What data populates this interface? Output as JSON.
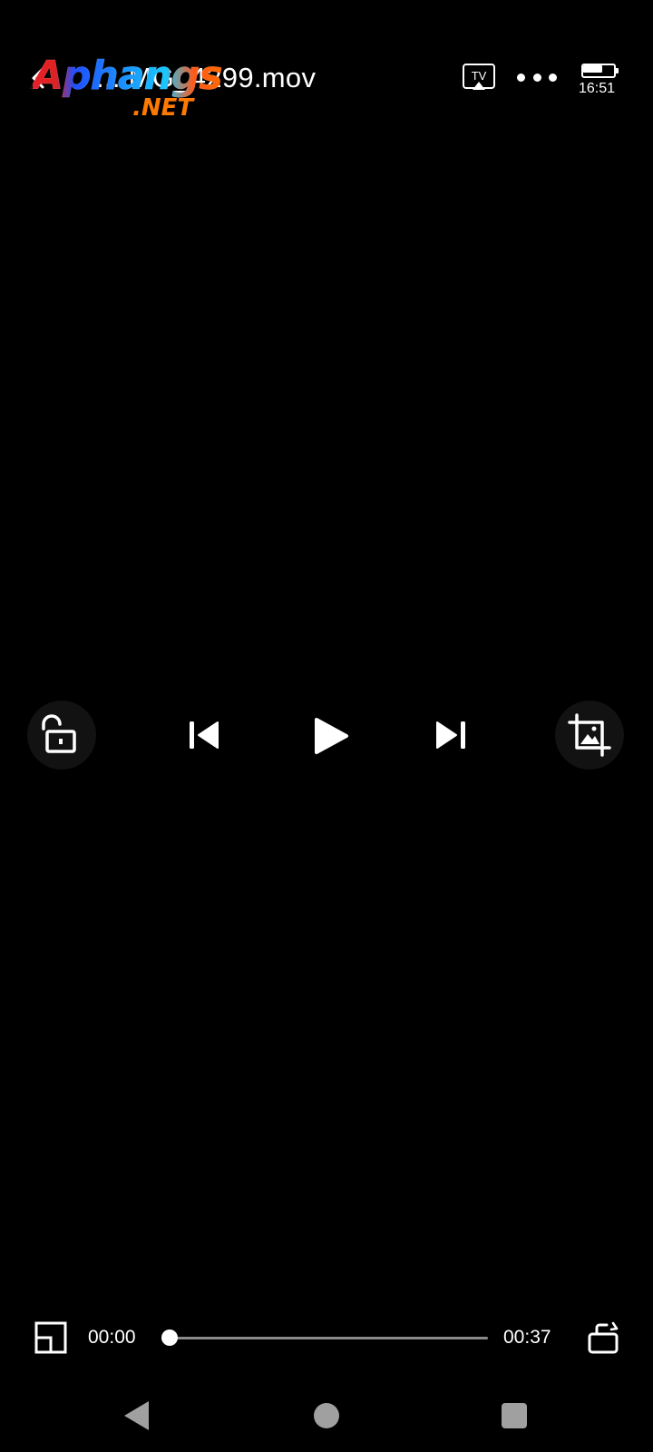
{
  "header": {
    "title": "48 ... IMG_4299.mov",
    "title_visible": "... MG_4299.mov",
    "cast_label": "TV",
    "clock": "16:51",
    "battery_level": 0.7
  },
  "watermark": {
    "brand": "Aphangs",
    "suffix": ".NET"
  },
  "playback": {
    "current_time": "00:00",
    "total_time": "00:37",
    "progress": 0.0
  },
  "icons": {
    "back": "chevron-left-icon",
    "cast": "tv-cast-icon",
    "more": "more-dots-icon",
    "lock": "unlock-icon",
    "previous": "skip-previous-icon",
    "play": "play-icon",
    "next": "skip-next-icon",
    "crop": "crop-icon",
    "pip": "picture-in-picture-icon",
    "rotate": "screen-rotate-icon",
    "nav_back": "nav-back-icon",
    "nav_home": "nav-home-icon",
    "nav_recent": "nav-recent-icon"
  },
  "colors": {
    "background": "#000000",
    "foreground": "#ffffff",
    "track": "#8a8a8a",
    "nav": "#a0a0a0"
  }
}
